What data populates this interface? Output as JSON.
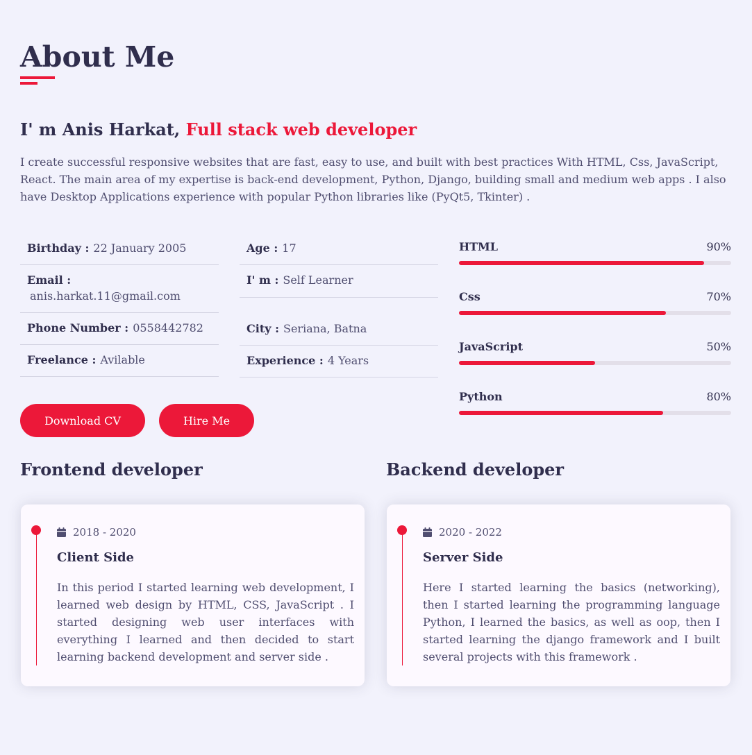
{
  "section": {
    "title": "About Me"
  },
  "intro": {
    "heading_prefix": "I' m Anis Harkat, ",
    "heading_accent": "Full stack web developer",
    "text": "I create successful responsive websites that are fast, easy to use, and built with best practices With HTML, Css, JavaScript, React. The main area of my expertise is back-end development, Python, Django, building small and medium web apps . I also have Desktop Applications experience with popular Python libraries like (PyQt5, Tkinter) ."
  },
  "info": {
    "col1": [
      {
        "label": "Birthday :",
        "value": "22 January 2005"
      },
      {
        "label": "Email :",
        "value": "anis.harkat.11@gmail.com"
      },
      {
        "label": "Phone Number :",
        "value": "0558442782"
      },
      {
        "label": "Freelance :",
        "value": "Avilable"
      }
    ],
    "col2": [
      {
        "label": "Age :",
        "value": "17"
      },
      {
        "label": "I' m :",
        "value": "Self Learner"
      },
      {
        "label": "City :",
        "value": "Seriana, Batna"
      },
      {
        "label": "Experience :",
        "value": "4 Years"
      }
    ]
  },
  "buttons": {
    "download_cv": "Download CV",
    "hire_me": "Hire Me"
  },
  "skills": [
    {
      "name": "HTML",
      "percent_label": "90%",
      "percent": 90
    },
    {
      "name": "Css",
      "percent_label": "70%",
      "percent": 76
    },
    {
      "name": "JavaScript",
      "percent_label": "50%",
      "percent": 50
    },
    {
      "name": "Python",
      "percent_label": "80%",
      "percent": 75
    }
  ],
  "timeline": {
    "frontend": {
      "title": "Frontend developer",
      "date": "2018 - 2020",
      "item_title": "Client Side",
      "text": "In this period I started learning web development, I learned web design by HTML, CSS, JavaScript . I started designing web user interfaces with everything I learned and then decided to start learning backend development and server side ."
    },
    "backend": {
      "title": "Backend developer",
      "date": "2020 - 2022",
      "item_title": "Server Side",
      "text": "Here I started learning the basics (networking), then I started learning the programming language Python, I learned the basics, as well as oop, then I started learning the django framework and I built several projects with this framework ."
    }
  },
  "colors": {
    "accent": "#ec1839",
    "background": "#f2f2fc",
    "heading": "#302e4d",
    "text": "#504e70"
  },
  "icons": {
    "date": "calendar-icon"
  }
}
